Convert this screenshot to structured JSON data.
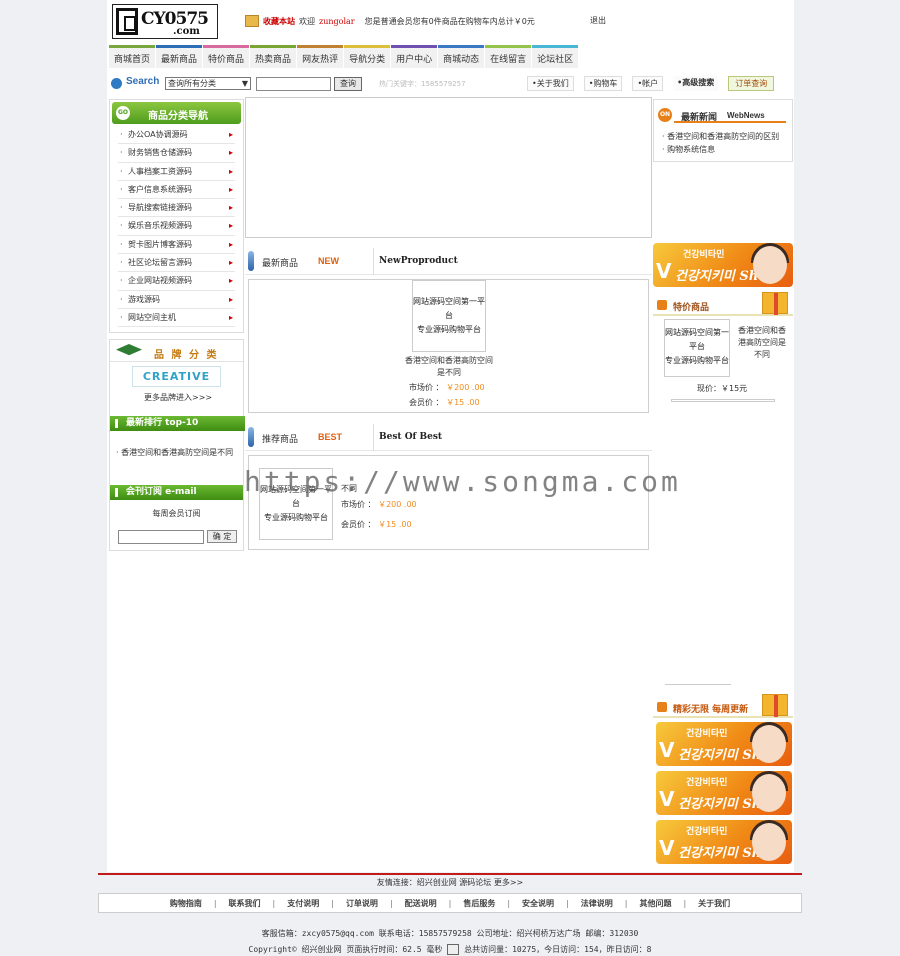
{
  "header": {
    "logo_name": "CY0575",
    "logo_domain": ".com",
    "favorite": "收藏本站",
    "welcome": "欢迎",
    "username": "zungolar",
    "cart_msg": "您是普通会员您有0件商品在购物车内总计￥0元",
    "logout": "退出"
  },
  "nav": [
    "商城首页",
    "最新商品",
    "特价商品",
    "热卖商品",
    "网友热评",
    "导航分类",
    "用户中心",
    "商城动态",
    "在线留言",
    "论坛社区"
  ],
  "search": {
    "label": "Search",
    "category": "查询所有分类",
    "button": "查询",
    "hot": "热门关键字：1585579257"
  },
  "quicklinks": [
    "关于我们",
    "购物车",
    "帐户",
    "高级搜索",
    "订单查询"
  ],
  "categories": {
    "title": "商品分类导航",
    "items": [
      "办公OA协调源码",
      "财务销售仓储源码",
      "人事档案工资源码",
      "客户信息系统源码",
      "导航搜索链接源码",
      "娱乐音乐视频源码",
      "贺卡图片博客源码",
      "社区论坛留言源码",
      "企业网站视频源码",
      "游戏源码",
      "网站空间主机"
    ]
  },
  "brand": {
    "title": "品 牌 分 类",
    "logo": "CREATIVE",
    "more": "更多品牌进入>>>"
  },
  "top10": {
    "title": "最新排行  top-10",
    "item": "· 香港空间和香港高防空间是不同"
  },
  "mail": {
    "title": "会刊订阅  e-mail",
    "label": "每周会员订阅",
    "button": "确 定"
  },
  "newest": {
    "t1": "最新商品",
    "t2": "NEW",
    "t3": "NewProproduct",
    "thumb": [
      "网站源码空间第一平台",
      "专业源码购物平台"
    ],
    "name": [
      "香港空间和香港高防空间",
      "是不同"
    ],
    "market_label": "市场价 ：",
    "market_value": "￥200 .00",
    "member_label": "会员价 ：",
    "member_value": "￥15 .00"
  },
  "recommend": {
    "t1": "推荐商品",
    "t2": "BEST",
    "t3": "Best Of Best",
    "thumb": [
      "网站源码空间第一平台",
      "专业源码购物平台"
    ],
    "name_frag": "不同",
    "market_label": "市场价 ：",
    "market_value": "￥200 .00",
    "member_label": "会员价 ：",
    "member_value": "￥15 .00"
  },
  "news": {
    "title": "最新新闻",
    "title_en": "WebNews",
    "items": [
      "· 香港空间和香港高防空间的区别",
      "· 购物系统信息"
    ]
  },
  "ad": {
    "kr": "건강비타민",
    "shop": "건강지키미 Shop"
  },
  "special": {
    "title": "特价商品",
    "thumb": [
      "网站源码空间第一平台",
      "专业源码购物平台"
    ],
    "name": [
      "香港空间和香",
      "港高防空间是",
      "不同"
    ],
    "price": "现价：￥15元"
  },
  "weekly": {
    "title": "精彩无限 每周更新"
  },
  "footer": {
    "friend": "友情连接：绍兴创业网  源码论坛  更多>>",
    "nav": [
      "购物指南",
      "联系我们",
      "支付说明",
      "订单说明",
      "配送说明",
      "售后服务",
      "安全说明",
      "法律说明",
      "其他问题",
      "关于我们"
    ],
    "info": "客服信箱：zxcy0575@qq.com    联系电话：15857579258    公司地址：绍兴柯桥万达广场    邮编：312030",
    "copyright": "Copyright© 绍兴创业网  页面执行时间：62.5 毫秒",
    "stats": " 总共访问量：10275，今日访问：154，昨日访问：8"
  },
  "watermark": "https://www.songma.com"
}
